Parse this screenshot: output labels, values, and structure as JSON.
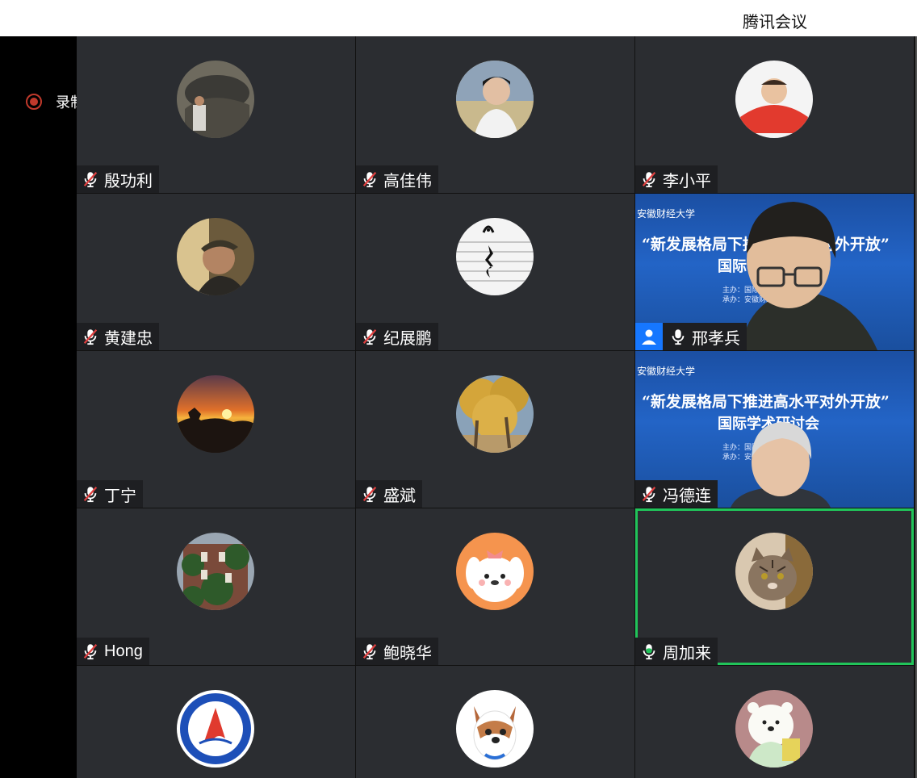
{
  "app": {
    "title": "腾讯会议"
  },
  "recording": {
    "label": "录制中"
  },
  "participants": [
    {
      "name": "殷功利",
      "mic": "muted"
    },
    {
      "name": "高佳伟",
      "mic": "muted"
    },
    {
      "name": "李小平",
      "mic": "muted"
    },
    {
      "name": "黄建忠",
      "mic": "muted"
    },
    {
      "name": "纪展鹏",
      "mic": "muted"
    },
    {
      "name": "邢孝兵",
      "mic": "on",
      "video": true
    },
    {
      "name": "丁宁",
      "mic": "muted"
    },
    {
      "name": "盛斌",
      "mic": "muted"
    },
    {
      "name": "冯德连",
      "mic": "muted",
      "video": true
    },
    {
      "name": "Hong",
      "mic": "muted"
    },
    {
      "name": "鲍晓华",
      "mic": "muted"
    },
    {
      "name": "周加来",
      "mic": "speaking",
      "active": true
    },
    {
      "name": "",
      "mic": ""
    },
    {
      "name": "",
      "mic": ""
    },
    {
      "name": "",
      "mic": ""
    }
  ],
  "video_banner": {
    "school": "安徽财经大学",
    "title_line1": "“新发展格局下推进高水平对外开放”",
    "title_line2": "国际学术研讨会",
    "host": "主办：国际经济贸易学院",
    "organizer": "承办：安徽财经大学"
  },
  "colors": {
    "tile_bg": "#2b2d31",
    "active_border": "#21c45a",
    "muted_red": "#e04040",
    "speaking_green": "#21c45a",
    "profile_blue": "#1677ff"
  }
}
